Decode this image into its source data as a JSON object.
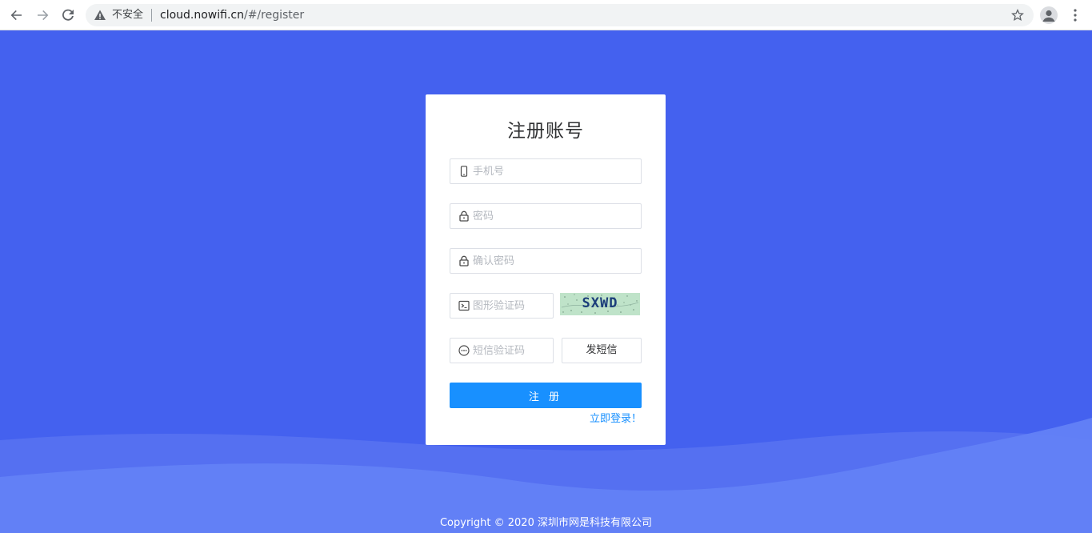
{
  "browser": {
    "security_label": "不安全",
    "url_host": "cloud.nowifi.cn",
    "url_path": "/#/register"
  },
  "form": {
    "title": "注册账号",
    "phone_placeholder": "手机号",
    "password_placeholder": "密码",
    "confirm_placeholder": "确认密码",
    "captcha_placeholder": "图形验证码",
    "captcha_image_text": "SXWD",
    "sms_placeholder": "短信验证码",
    "sms_button": "发短信",
    "submit_button": "注 册",
    "login_link": "立即登录！"
  },
  "footer": {
    "copyright": "Copyright © 2020 深圳市网是科技有限公司"
  },
  "colors": {
    "background": "#4461ef",
    "primary": "#1890ff",
    "card": "#ffffff"
  },
  "icons": {
    "phone": "mobile-icon",
    "password": "lock-icon",
    "confirm": "lock-icon",
    "captcha": "terminal-icon",
    "sms": "chat-dots-icon"
  }
}
